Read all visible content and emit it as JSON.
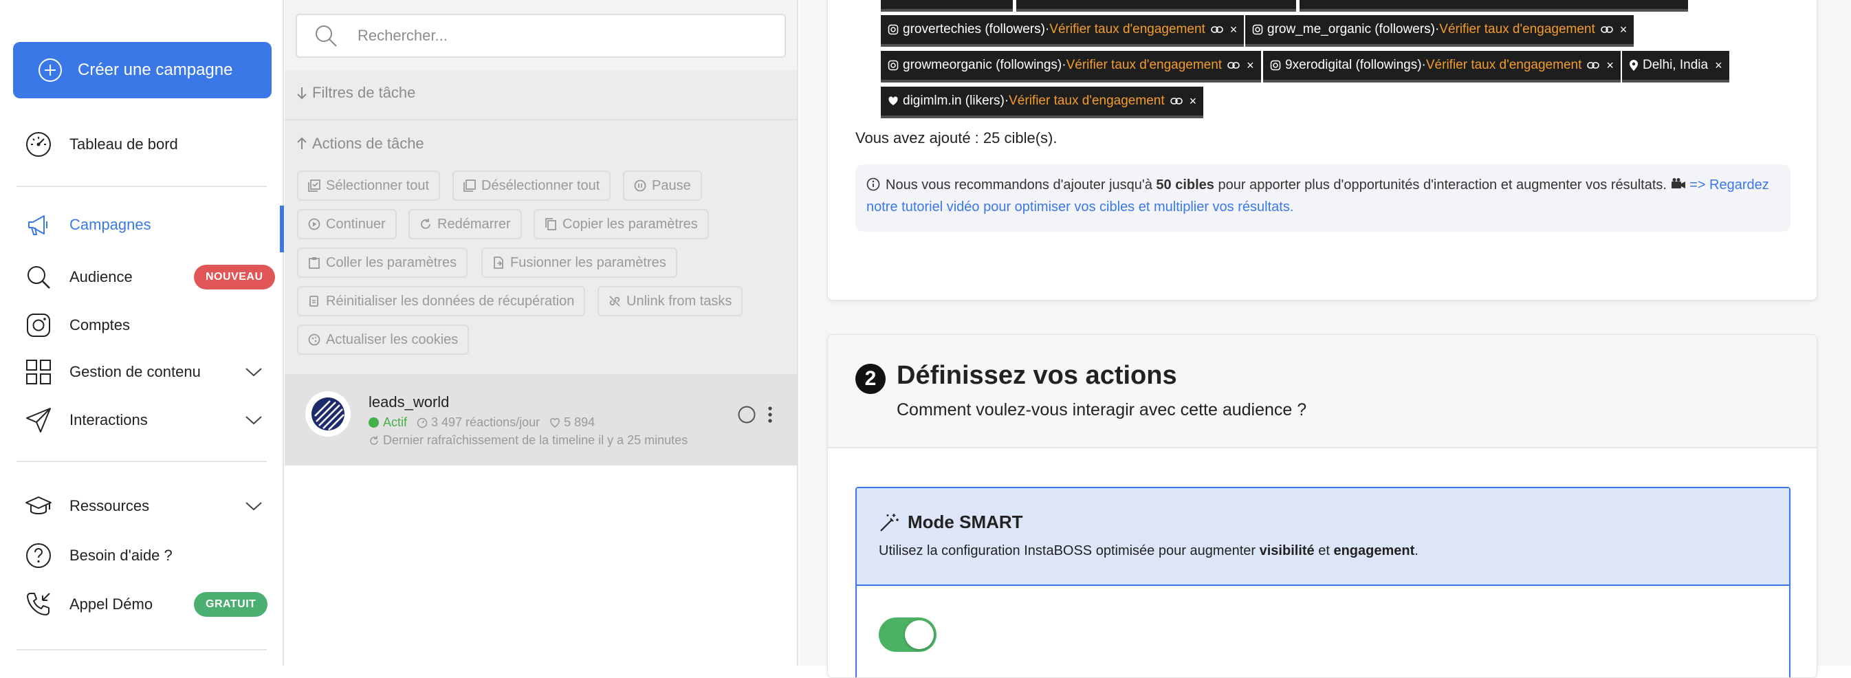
{
  "sidebar": {
    "create_campaign": "Créer une campagne",
    "items": {
      "dashboard": "Tableau de bord",
      "campaigns": "Campagnes",
      "audience": "Audience",
      "accounts": "Comptes",
      "content": "Gestion de contenu",
      "interactions": "Interactions",
      "resources": "Ressources",
      "help": "Besoin d'aide ?",
      "demo": "Appel Démo"
    },
    "badges": {
      "audience": "NOUVEAU",
      "demo": "GRATUIT"
    },
    "colors": {
      "accent": "#3b78e7",
      "badge_new": "#e05555",
      "badge_free": "#4caf72"
    }
  },
  "middle": {
    "search_placeholder": "Rechercher...",
    "filters_title": "Filtres de tâche",
    "actions_title": "Actions de tâche",
    "actions": {
      "select_all": "Sélectionner tout",
      "deselect_all": "Désélectionner tout",
      "pause": "Pause",
      "continue": "Continuer",
      "restart": "Redémarrer",
      "copy_params": "Copier les paramètres",
      "paste_params": "Coller les paramètres",
      "merge_params": "Fusionner les paramètres",
      "reset_data": "Réinitialiser les données de récupération",
      "unlink": "Unlink from tasks",
      "refresh_cookies": "Actualiser les cookies"
    },
    "task": {
      "name": "leads_world",
      "status": "Actif",
      "reactions": "3 497 réactions/jour",
      "likes": "5 894",
      "refresh": "Dernier rafraîchissement de la timeline il y a 25 minutes"
    }
  },
  "right": {
    "targets": {
      "t1_name": "grovertechies (followers)",
      "t2_name": "grow_me_organic (followers)",
      "t3_name": "growmeorganic (followings)",
      "t4_name": "9xerodigital (followings)",
      "t5_name": "Delhi, India",
      "t6_name": "digimlm.in (likers)",
      "separator": " · ",
      "check_label": "Vérifier taux d'engagement",
      "close": "×"
    },
    "added_text": "Vous avez ajouté : 25 cible(s).",
    "info": {
      "text1": "Nous vous recommandons d'ajouter jusqu'à",
      "bold": "50 cibles",
      "text2": "pour apporter plus d'opportunités d'interaction et augmenter vos résultats.",
      "link": "=> Regardez notre tutoriel vidéo pour optimiser vos cibles et multiplier vos résultats."
    },
    "step": {
      "number": "2",
      "title": "Définissez vos actions",
      "subtitle": "Comment voulez-vous interagir avec cette audience ?"
    },
    "smart": {
      "title": "Mode SMART",
      "desc1": "Utilisez la configuration InstaBOSS optimisée pour augmenter",
      "bold1": "visibilité",
      "and": "et",
      "bold2": "engagement",
      "end": ".",
      "toggle_on": true
    },
    "colors": {
      "tag_bg": "#1e1e1e",
      "orange": "#f39c2b",
      "toggle": "#4cb263",
      "smart_bg": "#dde6f8"
    }
  }
}
